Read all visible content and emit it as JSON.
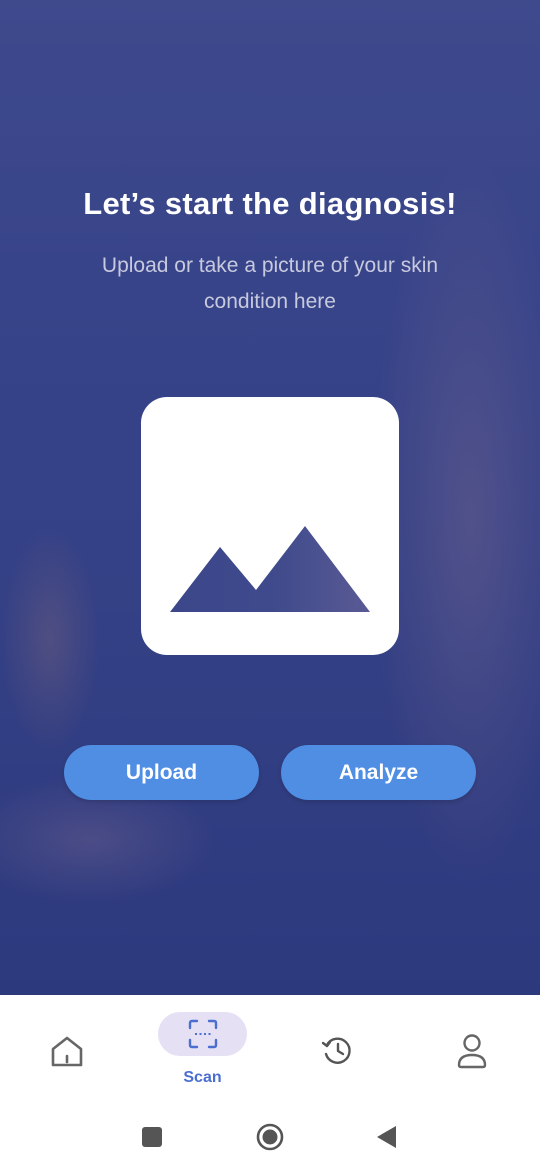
{
  "screen": {
    "title": "Let’s start the diagnosis!",
    "subtitle": "Upload or take a picture of your skin condition here"
  },
  "image_placeholder": {
    "icon": "image-placeholder-icon"
  },
  "actions": {
    "upload_label": "Upload",
    "analyze_label": "Analyze"
  },
  "bottom_nav": {
    "items": [
      {
        "icon": "home-icon",
        "label": ""
      },
      {
        "icon": "scan-icon",
        "label": "Scan",
        "active": true
      },
      {
        "icon": "history-icon",
        "label": ""
      },
      {
        "icon": "profile-icon",
        "label": ""
      }
    ]
  },
  "system_nav": {
    "buttons": [
      "recents-button",
      "home-button",
      "back-button"
    ]
  },
  "colors": {
    "accent": "#4f8ee3",
    "active_nav_bg": "#e6e0f5",
    "active_nav_text": "#4a6fd0",
    "overlay": "#3a4588"
  }
}
